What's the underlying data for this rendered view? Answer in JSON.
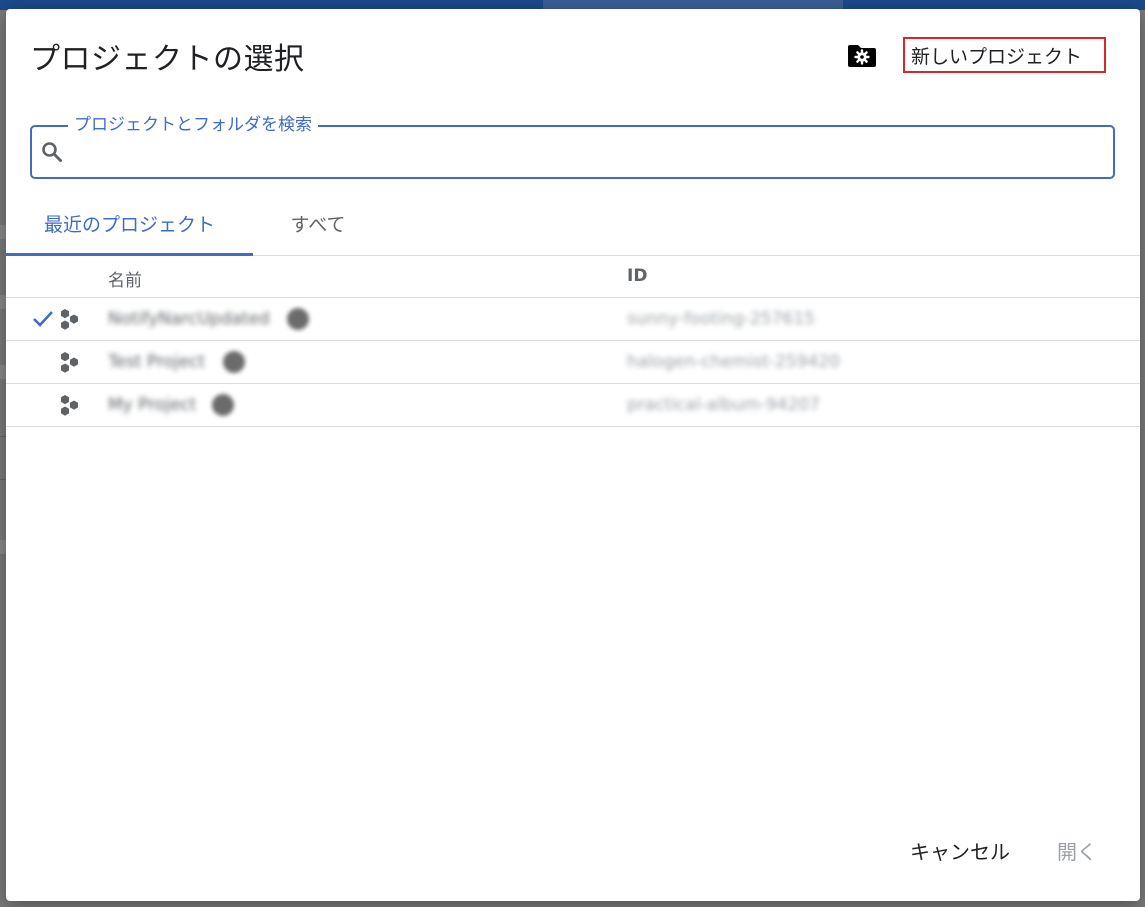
{
  "colors": {
    "accent": "#3f6cc4",
    "new_project_border": "#d8262b",
    "text_primary": "#202124",
    "text_secondary": "#5f6368",
    "text_disabled": "#9aa0a6",
    "overlay": "#7a7a7a"
  },
  "dialog": {
    "title": "プロジェクトの選択",
    "manage_icon": "folder-settings-icon",
    "new_project_label": "新しいプロジェクト"
  },
  "search": {
    "label": "プロジェクトとフォルダを検索",
    "value": "",
    "icon": "search-icon"
  },
  "tabs": [
    {
      "label": "最近のプロジェクト",
      "selected": true
    },
    {
      "label": "すべて",
      "selected": false
    }
  ],
  "table": {
    "columns": {
      "name": "名前",
      "id": "ID"
    },
    "rows": [
      {
        "name": "NotifyNarcUpdated",
        "id": "sunny-footing-257615",
        "selected": true,
        "icon": "project-hexagons-icon"
      },
      {
        "name": "Test Project",
        "id": "halogen-chemist-259420",
        "selected": false,
        "icon": "project-hexagons-icon"
      },
      {
        "name": "My Project",
        "id": "practical-album-94207",
        "selected": false,
        "icon": "project-hexagons-icon"
      }
    ]
  },
  "footer": {
    "cancel_label": "キャンセル",
    "open_label": "開く"
  }
}
